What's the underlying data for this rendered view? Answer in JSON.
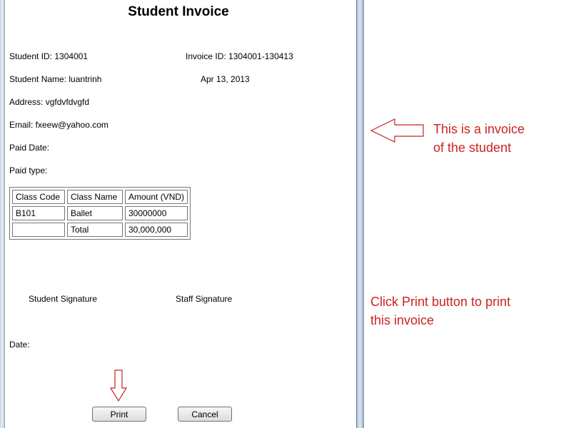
{
  "invoice": {
    "title": "Student Invoice",
    "student_id": "Student ID: 1304001",
    "invoice_id": "Invoice ID: 1304001-130413",
    "student_name": "Student Name: luantrinh",
    "date": "Apr 13, 2013",
    "address": "Address: vgfdvfdvgfd",
    "email": "Email: fxeew@yahoo.com",
    "paid_date": "Paid Date:",
    "paid_type": "Paid type:",
    "table": {
      "headers": [
        "Class Code",
        "Class Name",
        "Amount (VND)"
      ],
      "rows": [
        [
          "B101",
          "Ballet",
          "30000000"
        ],
        [
          "",
          "Total",
          "30,000,000"
        ]
      ]
    },
    "student_signature": "Student Signature",
    "staff_signature": "Staff Signature",
    "date_label": "Date:",
    "print_label": "Print",
    "cancel_label": "Cancel"
  },
  "annotations": {
    "invoice_note_line1": "This is a invoice",
    "invoice_note_line2": "of the student",
    "print_note_line1": "Click Print button to print",
    "print_note_line2": "this invoice",
    "color": "#cc2222"
  }
}
